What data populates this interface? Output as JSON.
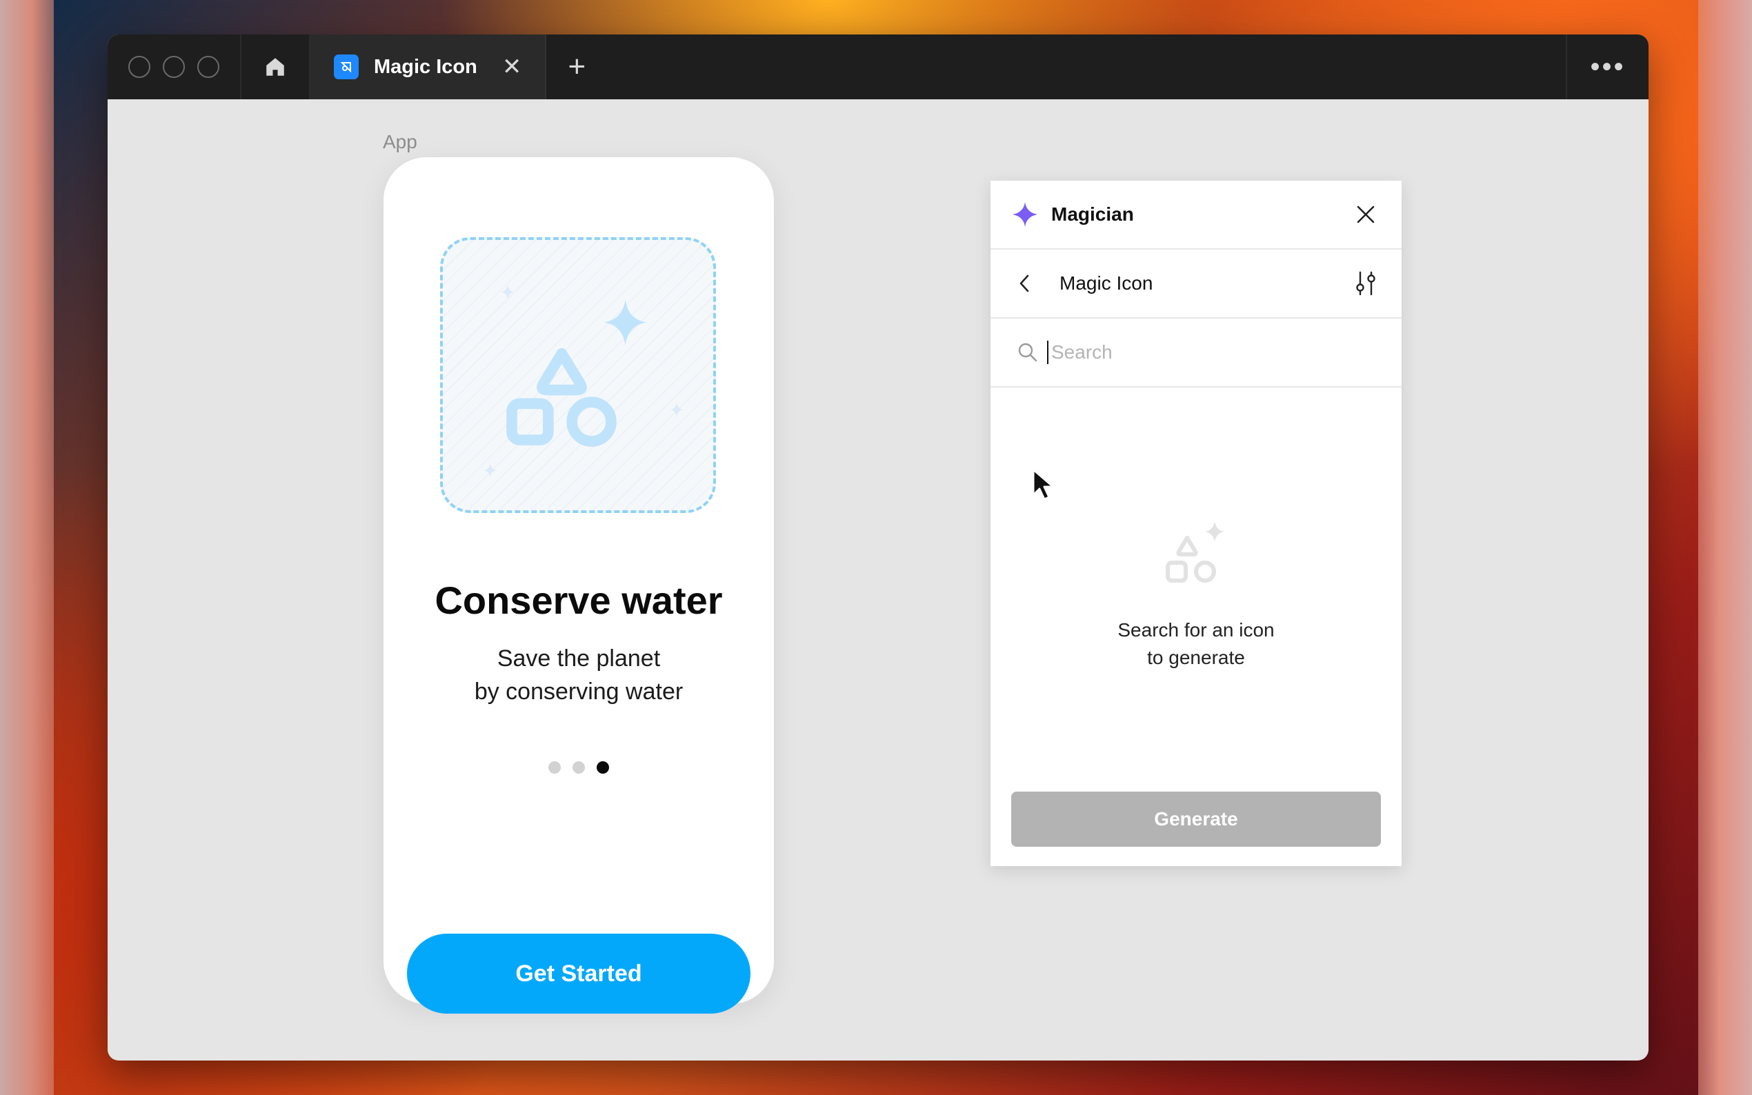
{
  "window": {
    "tab_title": "Magic Icon",
    "tab_close": "✕",
    "new_tab": "+",
    "more": "•••"
  },
  "canvas": {
    "frame_label": "App",
    "phone": {
      "headline": "Conserve water",
      "subtitle_line1": "Save the planet",
      "subtitle_line2": "by conserving water",
      "pagination": {
        "total": 3,
        "active_index": 2
      },
      "cta_label": "Get Started"
    }
  },
  "plugin": {
    "title": "Magician",
    "nav_title": "Magic Icon",
    "search_placeholder": "Search",
    "search_value": "",
    "empty_line1": "Search for an icon",
    "empty_line2": "to generate",
    "generate_label": "Generate"
  },
  "colors": {
    "accent_blue": "#04a8fb",
    "magician_purple": "#7b5cf5",
    "titlebar": "#1e1e1e",
    "disabled_button": "#b3b3b3"
  },
  "icons": {
    "home": "home-icon",
    "tab_app": "figma-plugin-icon",
    "sparkle": "sparkle-icon",
    "close": "close-icon",
    "back": "chevron-left-icon",
    "settings": "sliders-icon",
    "search": "search-icon",
    "shapes": "shapes-sparkle-icon",
    "cursor": "cursor-icon"
  }
}
